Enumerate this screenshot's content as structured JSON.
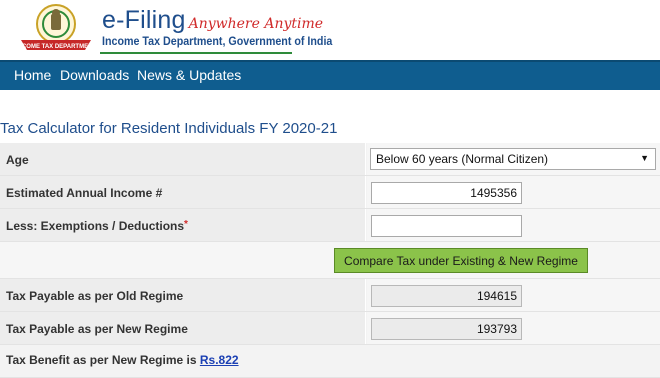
{
  "brand": {
    "title": "e-Filing",
    "tagline": "Anywhere Anytime",
    "subtitle": "Income Tax Department, Government of India",
    "emblem_banner": "INCOME TAX DEPARTMENT"
  },
  "nav": {
    "items": [
      "Home",
      "Downloads",
      "News & Updates"
    ]
  },
  "page": {
    "title": "Tax Calculator for Resident Individuals FY 2020-21"
  },
  "form": {
    "age_label": "Age",
    "age_value": "Below 60 years (Normal Citizen)",
    "income_label": "Estimated Annual Income #",
    "income_value": "1495356",
    "deductions_label": "Less: Exemptions / Deductions",
    "deductions_required": "*",
    "compare_button": "Compare Tax under Existing & New Regime",
    "old_regime_label": "Tax Payable as per Old Regime",
    "old_regime_value": "194615",
    "new_regime_label": "Tax Payable as per New Regime",
    "new_regime_value": "193793",
    "benefit_label": "Tax Benefit as per New Regime is",
    "benefit_value": "Rs.822"
  },
  "colors": {
    "nav_bg": "#0f5d8f",
    "brand_blue": "#1f4e8c",
    "accent_red": "#d02a2a",
    "button_green": "#8bc34a"
  }
}
